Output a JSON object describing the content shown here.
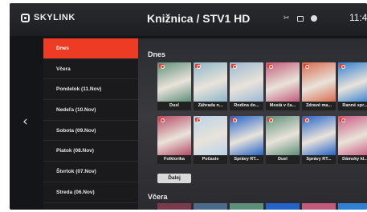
{
  "brand": {
    "name": "SKYLINK"
  },
  "header": {
    "title": "Knižnica / STV1 HD",
    "clock": "11:4"
  },
  "status_icons": [
    "settings-tools-icon",
    "recording-icon",
    "record-dot-icon"
  ],
  "sidebar": {
    "items": [
      {
        "label": "Dnes",
        "active": true
      },
      {
        "label": "Včera",
        "active": false
      },
      {
        "label": "Pondelok (11.Nov)",
        "active": false
      },
      {
        "label": "Nedeľa (10.Nov)",
        "active": false
      },
      {
        "label": "Sobota (09.Nov)",
        "active": false
      },
      {
        "label": "Piatok (08.Nov)",
        "active": false
      },
      {
        "label": "Štvrtok (07.Nov)",
        "active": false
      },
      {
        "label": "Streda (06.Nov)",
        "active": false
      }
    ]
  },
  "sections": {
    "today": {
      "title": "Dnes",
      "row1": [
        {
          "label": "Duel",
          "color": "#5d8f79"
        },
        {
          "label": "Záhrada n...",
          "color": "#8bb6c9"
        },
        {
          "label": "Rodina do...",
          "color": "#9bb8d3"
        },
        {
          "label": "Mestá v ča...",
          "color": "#c25a7a"
        },
        {
          "label": "Zdravé ma...",
          "color": "#d86b4e"
        },
        {
          "label": "Ranné spr...",
          "color": "#2f7fd3"
        }
      ],
      "row2": [
        {
          "label": "Folklorika",
          "color": "#b54a66"
        },
        {
          "label": "Počasie",
          "color": "#b9d2e8"
        },
        {
          "label": "Správy RT...",
          "color": "#2463c8"
        },
        {
          "label": "Duel",
          "color": "#5d8f79"
        },
        {
          "label": "Správy RT...",
          "color": "#2463c8"
        },
        {
          "label": "Dámsky kl...",
          "color": "#c95a80"
        }
      ],
      "more_label": "Ďalej"
    },
    "yesterday": {
      "title": "Včera"
    }
  }
}
